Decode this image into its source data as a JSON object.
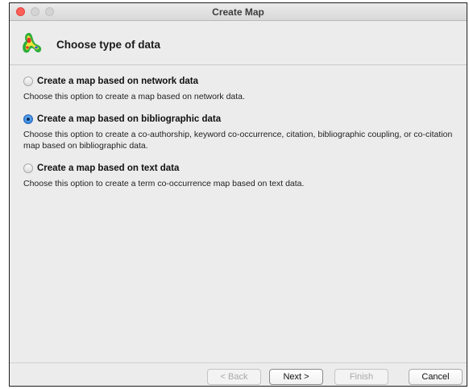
{
  "window": {
    "title": "Create Map"
  },
  "header": {
    "title": "Choose type of data",
    "icon": "vosviewer-density-map-icon"
  },
  "options": [
    {
      "label": "Create a map based on network data",
      "description": "Choose this option to create a map based on network data.",
      "selected": false
    },
    {
      "label": "Create a map based on bibliographic data",
      "description": "Choose this option to create a co-authorship, keyword co-occurrence, citation, bibliographic coupling, or co-citation map based on bibliographic data.",
      "selected": true
    },
    {
      "label": "Create a map based on text data",
      "description": "Choose this option to create a term co-occurrence map based on text data.",
      "selected": false
    }
  ],
  "buttons": {
    "back": "< Back",
    "next": "Next >",
    "finish": "Finish",
    "cancel": "Cancel"
  },
  "colors": {
    "close": "#fe5f57",
    "selected_radio": "#3a8ee6"
  }
}
